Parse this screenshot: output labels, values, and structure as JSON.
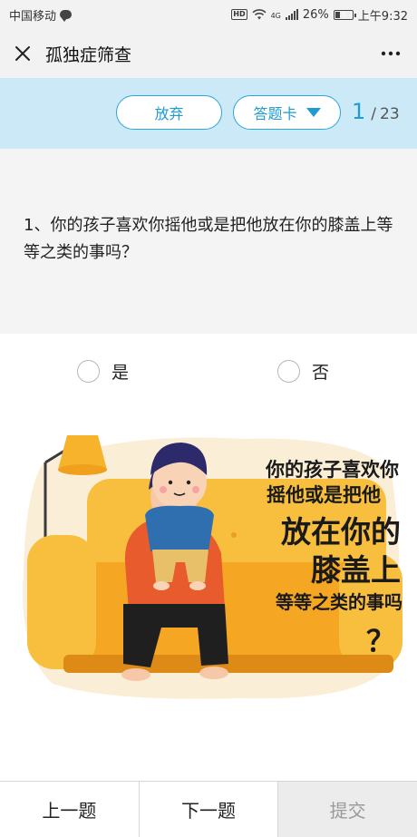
{
  "status_bar": {
    "carrier": "中国移动",
    "network": "4G",
    "battery": "26%",
    "battery_level": 0.26,
    "time": "上午9:32",
    "icons": [
      "wechat-icon",
      "hd-icon",
      "wifi-icon",
      "signal-icon",
      "battery-icon"
    ]
  },
  "title_bar": {
    "title": "孤独症筛查",
    "close_icon": "close-icon",
    "more_icon": "more-icon"
  },
  "toolbar": {
    "quit_label": "放弃",
    "card_label": "答题卡",
    "current": "1",
    "separator": "/",
    "total": "23",
    "accent": "#1d9bd2",
    "background": "#cbe9f6"
  },
  "question": {
    "text": "1、你的孩子喜欢你摇他或是把他放在你的膝盖上等等之类的事吗？"
  },
  "options": [
    {
      "label": "是",
      "selected": false
    },
    {
      "label": "否",
      "selected": false
    }
  ],
  "illustration": {
    "line1": "你的孩子喜欢你",
    "line2": "摇他或是把他",
    "line3": "放在你的",
    "line4": "膝盖上",
    "line5": "等等之类的事吗",
    "line6": "？"
  },
  "bottom_nav": {
    "prev_label": "上一题",
    "next_label": "下一题",
    "submit_label": "提交"
  }
}
